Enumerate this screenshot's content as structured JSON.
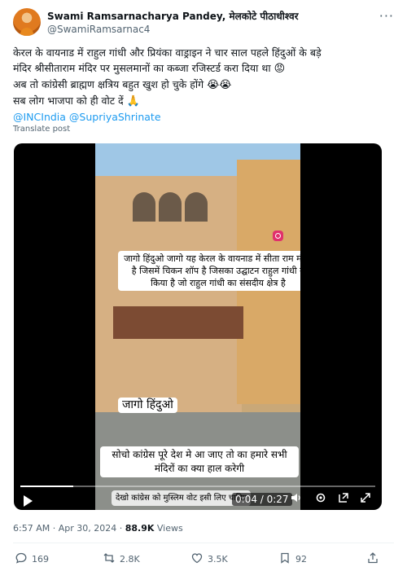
{
  "author": {
    "name": "Swami Ramsarnacharya Pandey, मेलकोटे पीठाधीश्वर",
    "handle": "@SwamiRamsarnac4"
  },
  "tweet": {
    "line1": "केरल के वायनाड में राहुल गांधी और प्रियंका वाड्राइन ने चार साल पहले हिंदुओं के बड़े",
    "line2": "मंदिर श्रीसीताराम मंदिर पर मुसलमानों का कब्जा रजिस्टर्ड करा दिया था",
    "line2_emoji": "😡",
    "line3": "अब तो कांग्रेसी ब्राह्मण क्षत्रिय बहुत खुश हो चुके होंगे",
    "line3_emoji": "😭😭",
    "line4": "सब लोग भाजपा को ही वोट दें",
    "line4_emoji": "🙏",
    "mentions": "@INCIndia @SupriyaShrinate",
    "translate": "Translate post"
  },
  "video": {
    "caption1": "जागो हिंदुओ जागो यह केरल के वायनाड में सीता राम मंदिर है जिसमें चिकन शॉप है जिसका उद्घाटन राहुल गांधी ने किया है जो राहुल गांधी का संसदीय क्षेत्र है",
    "caption2": "जागो हिंदुओ",
    "caption3": "सोचो कांग्रेस पूरे देश मे आ जाए तो का हमारे सभी मंदिरों का क्या हाल करेगी",
    "caption4": "देखो कांग्रेस को मुस्लिम वोट इसी लिए चाहिए",
    "time": "0:04 / 0:27",
    "progress": 0.148,
    "icons": [
      "play-icon",
      "volume-icon",
      "settings-icon",
      "popout-icon",
      "fullscreen-icon"
    ]
  },
  "meta": {
    "time_date": "6:57 AM · Apr 30, 2024 · ",
    "views_count": "88.9K",
    "views_label": " Views"
  },
  "actions": {
    "replies": "169",
    "reposts": "2.8K",
    "likes": "3.5K",
    "bookmarks": "92"
  },
  "colors": {
    "link": "#1d9bf0",
    "secondary_text": "#536471"
  }
}
